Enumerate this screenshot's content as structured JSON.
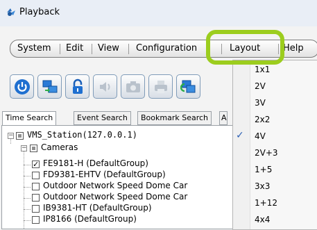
{
  "window": {
    "title": "Playback",
    "icon": "playback-app-icon"
  },
  "menu": {
    "items": [
      {
        "label": "System"
      },
      {
        "label": "Edit"
      },
      {
        "label": "View"
      },
      {
        "label": "Configuration"
      },
      {
        "label": "Layout"
      },
      {
        "label": "Help"
      }
    ],
    "highlight_color": "#9ccd1e"
  },
  "toolbar": {
    "buttons": [
      {
        "icon": "power-icon"
      },
      {
        "icon": "display-swap-icon"
      },
      {
        "icon": "lock-icon"
      },
      {
        "icon": "speaker-icon"
      },
      {
        "icon": "camera-snapshot-icon"
      },
      {
        "icon": "print-icon"
      },
      {
        "icon": "export-icon"
      }
    ]
  },
  "tabs": [
    {
      "label": "Time Search"
    },
    {
      "label": "Event Search"
    },
    {
      "label": "Bookmark Search"
    }
  ],
  "tree": {
    "station": "VMS_Station(127.0.0.1)",
    "group": "Cameras",
    "cameras": [
      {
        "label": "FE9181-H (DefaultGroup)",
        "checked": true
      },
      {
        "label": "FD9381-EHTV (DefaultGroup)",
        "checked": false
      },
      {
        "label": "Outdoor Network Speed Dome Car",
        "checked": false
      },
      {
        "label": "Outdoor Network Speed Dome Car",
        "checked": false
      },
      {
        "label": "IB9381-HT (DefaultGroup)",
        "checked": false
      },
      {
        "label": "IP8166 (DefaultGroup)",
        "checked": false
      }
    ]
  },
  "layout_menu": {
    "items": [
      "1x1",
      "2V",
      "3V",
      "2x2",
      "4V",
      "2V+3",
      "1+5",
      "3x3",
      "1+12",
      "4x4"
    ],
    "selected": "4V",
    "check_icon": "checkmark-icon"
  }
}
